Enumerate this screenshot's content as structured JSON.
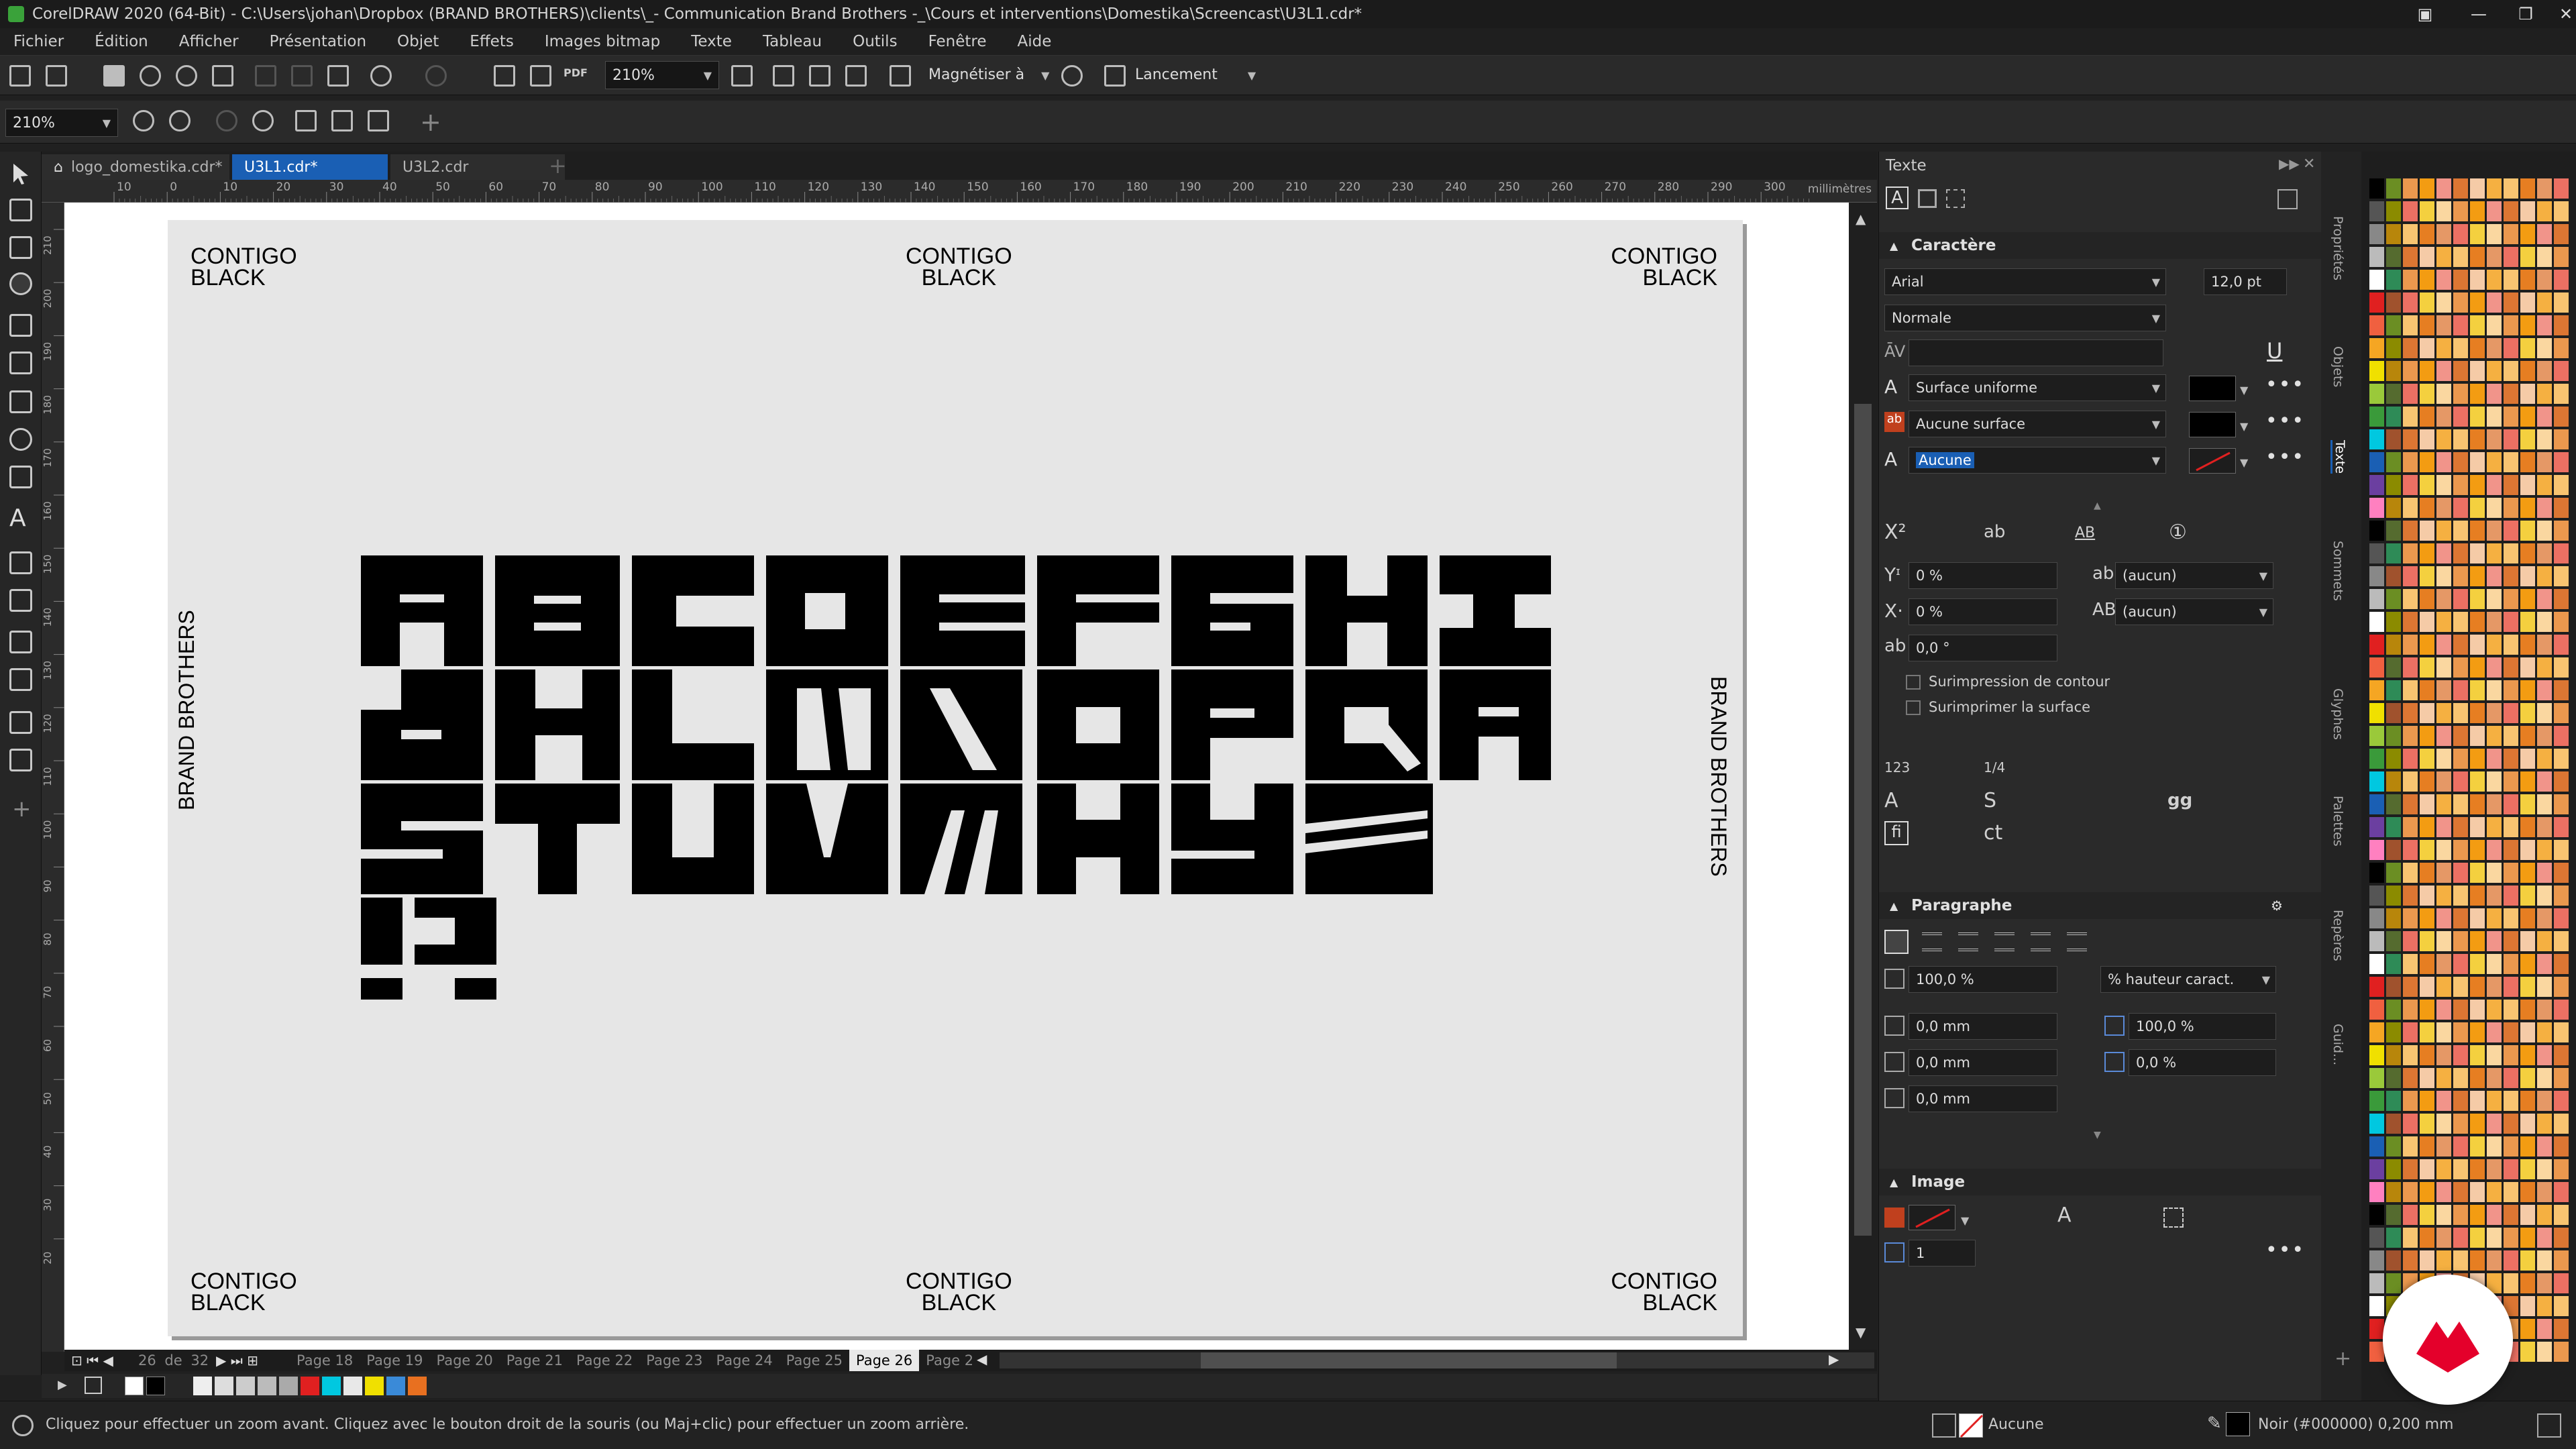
{
  "window": {
    "title": "CorelDRAW 2020 (64-Bit) - C:\\Users\\johan\\Dropbox (BRAND BROTHERS)\\clients\\_- Communication Brand Brothers -_\\Cours et interventions\\Domestika\\Screencast\\U3L1.cdr*"
  },
  "menu": [
    "Fichier",
    "Édition",
    "Afficher",
    "Présentation",
    "Objet",
    "Effets",
    "Images bitmap",
    "Texte",
    "Tableau",
    "Outils",
    "Fenêtre",
    "Aide"
  ],
  "toolbar": {
    "zoom_value": "210%",
    "snap_label": "Magnétiser à",
    "launch_label": "Lancement",
    "pdf_label": "PDF"
  },
  "toolbar2": {
    "zoom_value": "210%"
  },
  "tabs": [
    "logo_domestika.cdr*",
    "U3L1.cdr*",
    "U3L2.cdr"
  ],
  "ruler": {
    "unit": "millimètres",
    "ticks": [
      "10",
      "0",
      "10",
      "20",
      "30",
      "40",
      "50",
      "60",
      "70",
      "80",
      "90",
      "100",
      "110",
      "120",
      "130",
      "140",
      "150",
      "160",
      "170",
      "180",
      "190",
      "200",
      "210",
      "220",
      "230",
      "240",
      "250",
      "260",
      "270",
      "280",
      "290",
      "300"
    ],
    "vticks": [
      "210",
      "200",
      "190",
      "180",
      "170",
      "160",
      "150",
      "140",
      "130",
      "120",
      "110",
      "100",
      "90",
      "80",
      "70",
      "60",
      "50",
      "40",
      "30",
      "20"
    ]
  },
  "artboard": {
    "corner_label": "CONTIGO\nBLACK",
    "side_label": "BRAND BROTHERS",
    "alphabet_rows": [
      "ABCDEFGHI",
      "JKLMNOPQR",
      "STUVWXYZ",
      "!?"
    ]
  },
  "pages": {
    "current": "26",
    "of_label": "de",
    "total": "32",
    "tabs": [
      "Page 18",
      "Page 19",
      "Page 20",
      "Page 21",
      "Page 22",
      "Page 23",
      "Page 24",
      "Page 25",
      "Page 26",
      "Page 2"
    ]
  },
  "panel": {
    "title": "Texte",
    "character": {
      "header": "Caractère",
      "font": "Arial",
      "size": "12,0 pt",
      "style": "Normale",
      "fill": "Surface uniforme",
      "background": "Aucune surface",
      "outline": "Aucune",
      "shift_y": "0 %",
      "shift_x": "0 %",
      "angle": "0,0 °",
      "underline_opt": "(aucun)",
      "caps_opt": "(aucun)",
      "overprint_outline": "Surimpression de contour",
      "overprint_fill": "Surimprimer la surface",
      "numeric_label": "123",
      "fraction_label": "1/4"
    },
    "paragraph": {
      "header": "Paragraphe",
      "line_spacing": "100,0 %",
      "line_unit": "% hauteur caract.",
      "indent1": "0,0 mm",
      "indent2": "0,0 mm",
      "indent3": "0,0 mm",
      "char_spacing": "100,0 %",
      "word_spacing": "0,0 %"
    },
    "image": {
      "header": "Image",
      "columns": "1"
    }
  },
  "dockers": [
    "Propriétés",
    "Objets",
    "Texte",
    "Sommets",
    "Glyphes",
    "Palettes",
    "Repères",
    "Guid..."
  ],
  "status": {
    "hint": "Cliquez pour effectuer un zoom avant. Cliquez avec le bouton droit de la souris (ou Maj+clic) pour effectuer un zoom arrière.",
    "fill": "Aucune",
    "outline": "Noir (#000000)  0,200 mm"
  },
  "colors": {
    "accent": "#1a5fb4",
    "domestika": "#e4002b",
    "palette": [
      "#000000",
      "#e02020",
      "#00c8e0",
      "#e0e0e0",
      "#f5a623",
      "#6b3fa0",
      "#f0e000",
      "#e84d0e",
      "#ff80c0",
      "#3a9a3a"
    ]
  }
}
